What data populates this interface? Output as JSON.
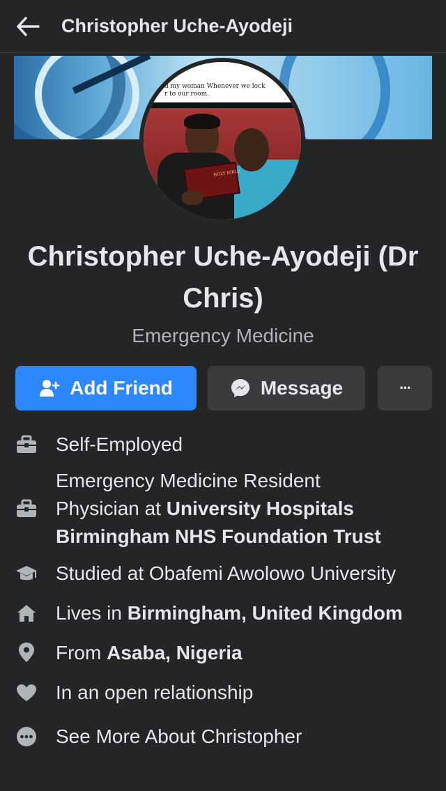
{
  "header": {
    "title": "Christopher Uche-Ayodeji"
  },
  "profile": {
    "name": "Christopher Uche-Ayodeji (Dr Chris)",
    "subtitle": "Emergency Medicine",
    "cover_caption_1": "d my woman Whenever we lock",
    "cover_caption_2": "r to our room.",
    "book_text": "HOLY BIBLE"
  },
  "actions": {
    "add_friend": "Add Friend",
    "message": "Message",
    "more": "···"
  },
  "details": {
    "work1": "Self-Employed",
    "work2_line1": "Emergency Medicine Resident",
    "work2_prefix": "Physician at ",
    "work2_bold1": "University Hospitals",
    "work2_bold2": "Birmingham NHS Foundation Trust",
    "education": "Studied at Obafemi Awolowo University",
    "lives_prefix": "Lives in ",
    "lives_place": "Birmingham, United Kingdom",
    "from_prefix": "From ",
    "from_place": "Asaba, Nigeria",
    "relationship": "In an open relationship",
    "see_more": "See More About Christopher"
  },
  "colors": {
    "accent": "#2d88ff",
    "background": "#242526",
    "secondary_button": "#3a3b3c"
  }
}
